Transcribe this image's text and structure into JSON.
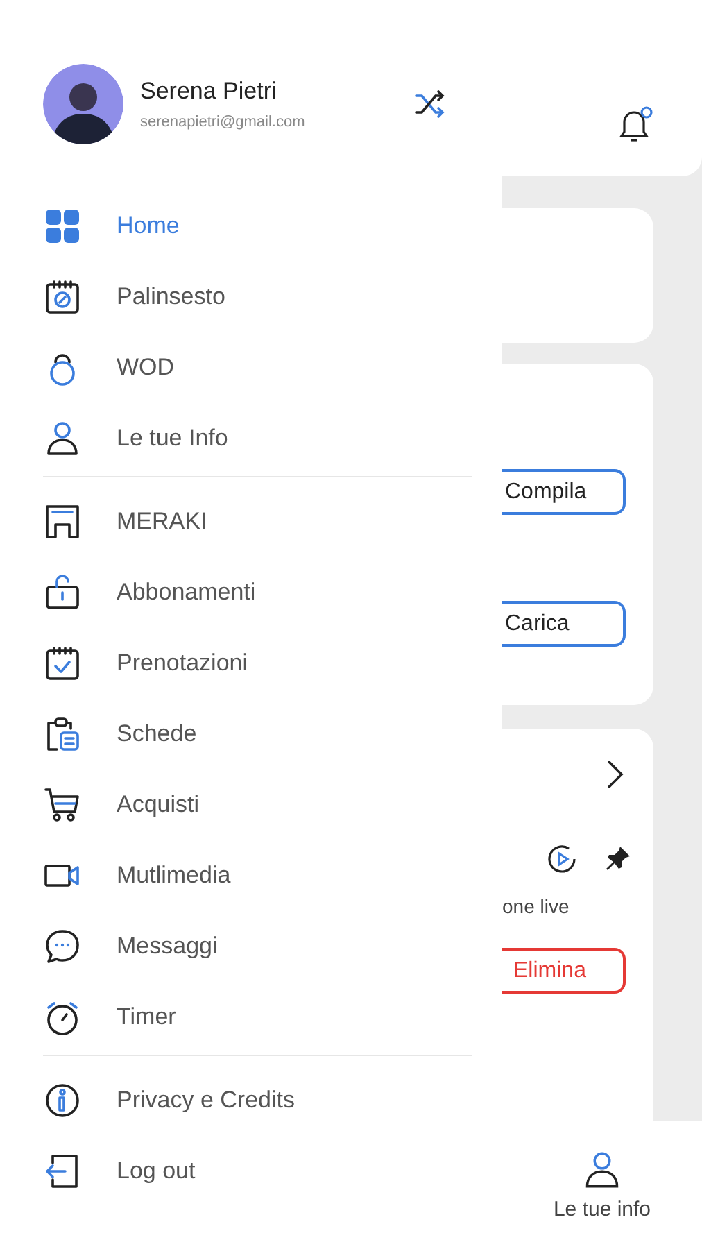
{
  "drawer": {
    "profile": {
      "name": "Serena Pietri",
      "email": "serenapietri@gmail.com"
    },
    "sections": [
      {
        "items": [
          {
            "label": "Home",
            "selected": true
          },
          {
            "label": "Palinsesto",
            "selected": false
          },
          {
            "label": "WOD",
            "selected": false
          },
          {
            "label": "Le tue Info",
            "selected": false
          }
        ]
      },
      {
        "items": [
          {
            "label": "MERAKI",
            "selected": false
          },
          {
            "label": "Abbonamenti",
            "selected": false
          },
          {
            "label": "Prenotazioni",
            "selected": false
          },
          {
            "label": "Schede",
            "selected": false
          },
          {
            "label": "Acquisti",
            "selected": false
          },
          {
            "label": "Mutlimedia",
            "selected": false
          },
          {
            "label": "Messaggi",
            "selected": false
          },
          {
            "label": "Timer",
            "selected": false
          }
        ]
      },
      {
        "items": [
          {
            "label": "Privacy e Credits",
            "selected": false
          },
          {
            "label": "Log out",
            "selected": false
          }
        ]
      }
    ]
  },
  "background": {
    "form_card": {
      "buttons": [
        {
          "label": "Compila"
        },
        {
          "label": "Carica"
        }
      ]
    },
    "live_card": {
      "caption": "one live",
      "delete_button": {
        "label": "Elimina"
      }
    },
    "bottom_nav": {
      "label": "Le tue info"
    }
  }
}
